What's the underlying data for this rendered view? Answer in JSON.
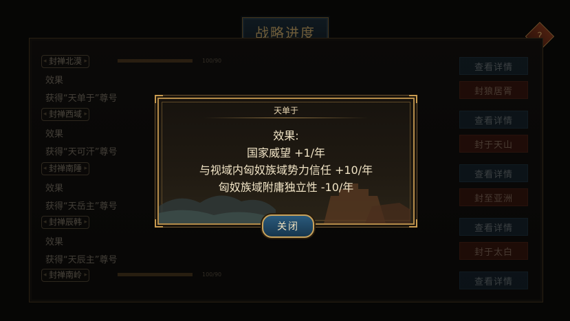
{
  "header": {
    "title": "战略进度"
  },
  "list": [
    {
      "label": "封禅北漠",
      "progress": "100/90",
      "effect_title": "效果",
      "effect_text": "获得“天单于”尊号"
    },
    {
      "label": "封禅西域",
      "progress": "",
      "effect_title": "效果",
      "effect_text": "获得“天可汗”尊号"
    },
    {
      "label": "封禅南陲",
      "progress": "",
      "effect_title": "效果",
      "effect_text": "获得“天岳主”尊号"
    },
    {
      "label": "封禅辰韩",
      "progress": "",
      "effect_title": "效果",
      "effect_text": "获得“天辰主”尊号"
    },
    {
      "label": "封禅南岭",
      "progress": "100/90"
    }
  ],
  "buttons": [
    {
      "label": "查看详情",
      "style": "blue"
    },
    {
      "label": "封狼居胥",
      "style": "red"
    },
    {
      "label": "查看详情",
      "style": "blue"
    },
    {
      "label": "封于天山",
      "style": "red"
    },
    {
      "label": "查看详情",
      "style": "blue"
    },
    {
      "label": "封至亚洲",
      "style": "red"
    },
    {
      "label": "查看详情",
      "style": "blue"
    },
    {
      "label": "封于太白",
      "style": "red"
    },
    {
      "label": "查看详情",
      "style": "blue"
    }
  ],
  "dialog": {
    "title": "天单于",
    "heading": "效果:",
    "lines": [
      "国家威望 +1/年",
      "与视域内匈奴族域势力信任 +10/年",
      "匈奴族域附庸独立性 -10/年"
    ],
    "close_label": "关闭"
  },
  "colors": {
    "gold": "#c9a869",
    "blue_button": "#1c3648",
    "red_button": "#5a1e12"
  }
}
